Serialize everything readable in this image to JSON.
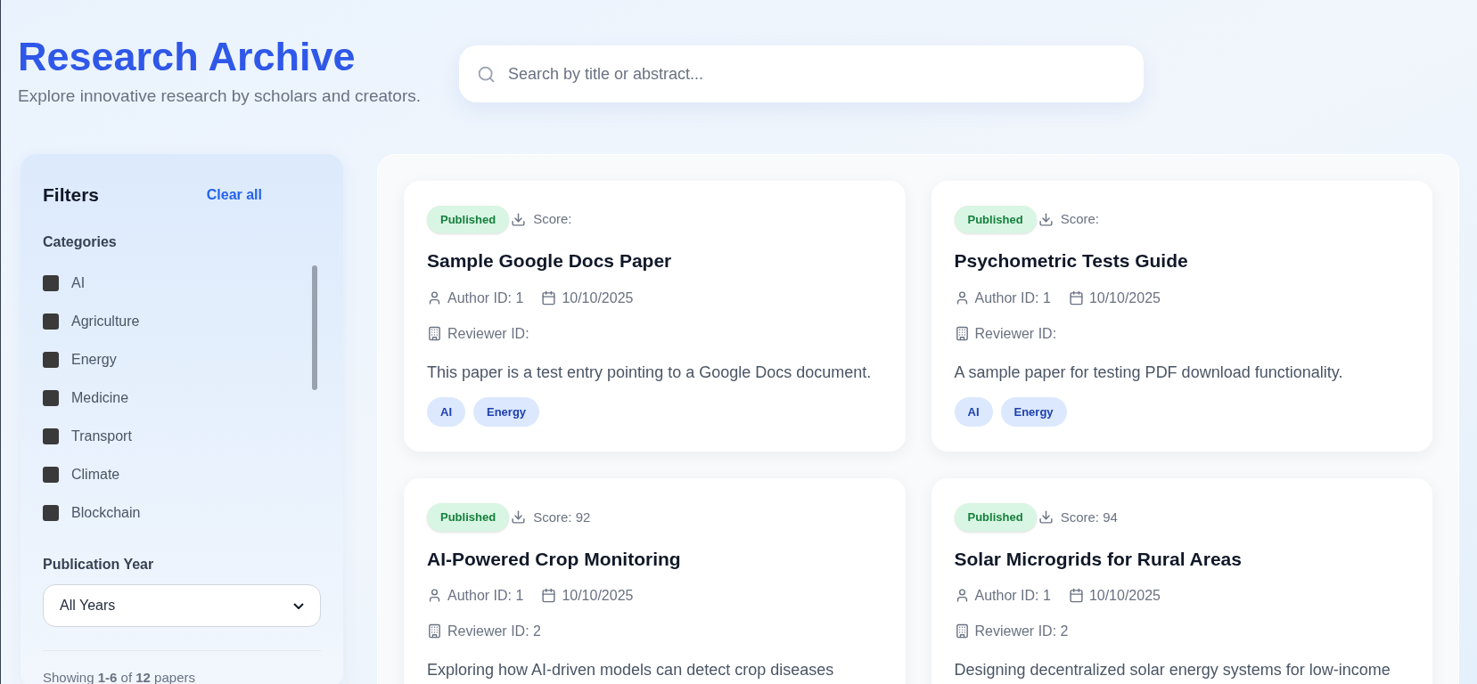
{
  "header": {
    "title": "Research Archive",
    "subtitle": "Explore innovative research by scholars and creators."
  },
  "search": {
    "placeholder": "Search by title or abstract..."
  },
  "filters": {
    "title": "Filters",
    "clear": "Clear all",
    "categories_label": "Categories",
    "categories": [
      {
        "label": "AI",
        "checked": false
      },
      {
        "label": "Agriculture",
        "checked": false
      },
      {
        "label": "Energy",
        "checked": false
      },
      {
        "label": "Medicine",
        "checked": false
      },
      {
        "label": "Transport",
        "checked": false
      },
      {
        "label": "Climate",
        "checked": false
      },
      {
        "label": "Blockchain",
        "checked": false
      }
    ],
    "year_label": "Publication Year",
    "year_value": "All Years",
    "showing": "Showing **1-6** of **12** papers"
  },
  "papers": [
    {
      "status": "Published",
      "score": "Score:",
      "title": "Sample Google Docs Paper",
      "author": "Author ID: 1",
      "date": "10/10/2025",
      "reviewer": "Reviewer ID:",
      "description": "This paper is a test entry pointing to a Google Docs document.",
      "tags": [
        "AI",
        "Energy"
      ]
    },
    {
      "status": "Published",
      "score": "Score:",
      "title": "Psychometric Tests Guide",
      "author": "Author ID: 1",
      "date": "10/10/2025",
      "reviewer": "Reviewer ID:",
      "description": "A sample paper for testing PDF download functionality.",
      "tags": [
        "AI",
        "Energy"
      ]
    },
    {
      "status": "Published",
      "score": "Score: 92",
      "title": "AI-Powered Crop Monitoring",
      "author": "Author ID: 1",
      "date": "10/10/2025",
      "reviewer": "Reviewer ID: 2",
      "description": "Exploring how AI-driven models can detect crop diseases"
    },
    {
      "status": "Published",
      "score": "Score: 94",
      "title": "Solar Microgrids for Rural Areas",
      "author": "Author ID: 1",
      "date": "10/10/2025",
      "reviewer": "Reviewer ID: 2",
      "description": "Designing decentralized solar energy systems for low-income"
    }
  ]
}
